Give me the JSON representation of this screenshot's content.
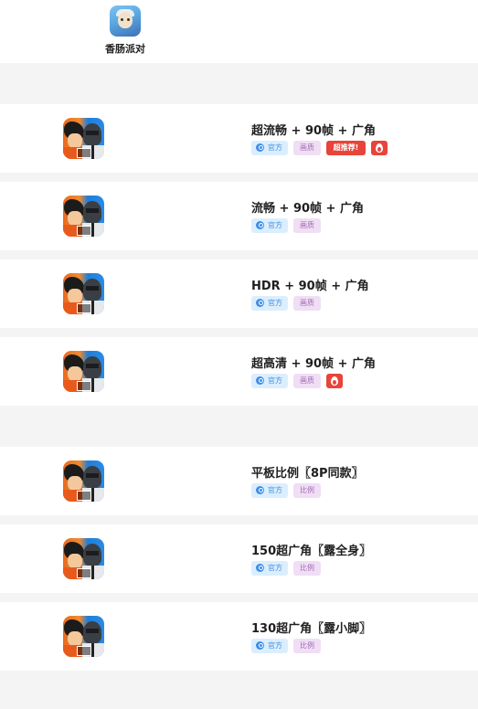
{
  "top_app": {
    "label": "香肠派对"
  },
  "section1": [
    {
      "title": "超流畅 + 90帧 + 广角",
      "tags": [
        "官方",
        "画质"
      ],
      "badge": "超推荐!",
      "hot": true
    },
    {
      "title": "流畅 + 90帧 + 广角",
      "tags": [
        "官方",
        "画质"
      ],
      "badge": null,
      "hot": false
    },
    {
      "title": "HDR + 90帧 + 广角",
      "tags": [
        "官方",
        "画质"
      ],
      "badge": null,
      "hot": false
    },
    {
      "title": "超高清 + 90帧 + 广角",
      "tags": [
        "官方",
        "画质"
      ],
      "badge": null,
      "hot": true
    }
  ],
  "section2": [
    {
      "title": "平板比例〖8P同款〗",
      "tags": [
        "官方",
        "比例"
      ]
    },
    {
      "title": "150超广角〖露全身〗",
      "tags": [
        "官方",
        "比例"
      ]
    },
    {
      "title": "130超广角〖露小脚〗",
      "tags": [
        "官方",
        "比例"
      ]
    }
  ],
  "colors": {
    "official_bg": "#dbeefe",
    "official_text": "#3e8fe0",
    "category_bg": "#f0def5",
    "category_text": "#a06cb2",
    "hot_red": "#e8443a"
  },
  "icons": {
    "top_app": "sausage-party-game-icon",
    "row_thumb": "game-avatar-icon",
    "official": "official-badge-icon",
    "hot": "fire-icon"
  }
}
